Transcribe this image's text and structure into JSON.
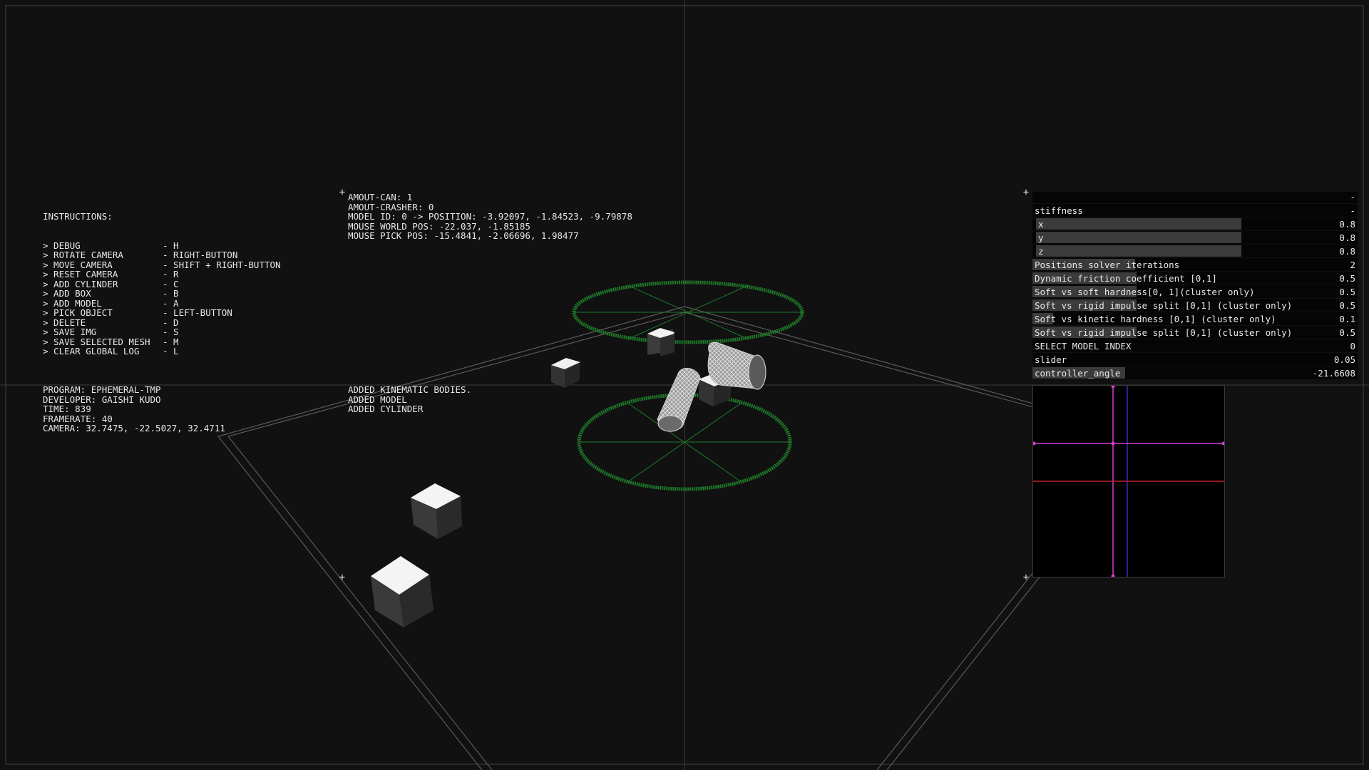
{
  "instructions": {
    "title": "INSTRUCTIONS:",
    "items": [
      {
        "action": "> DEBUG",
        "key": "- H"
      },
      {
        "action": "> ROTATE CAMERA",
        "key": "- RIGHT-BUTTON"
      },
      {
        "action": "> MOVE CAMERA",
        "key": "- SHIFT + RIGHT-BUTTON"
      },
      {
        "action": "> RESET CAMERA",
        "key": "- R"
      },
      {
        "action": "> ADD CYLINDER",
        "key": "- C"
      },
      {
        "action": "> ADD BOX",
        "key": "- B"
      },
      {
        "action": "> ADD MODEL",
        "key": "- A"
      },
      {
        "action": "> PICK OBJECT",
        "key": "- LEFT-BUTTON"
      },
      {
        "action": "> DELETE",
        "key": "- D"
      },
      {
        "action": "> SAVE IMG",
        "key": "- S"
      },
      {
        "action": "> SAVE SELECTED MESH",
        "key": "- M"
      },
      {
        "action": "> CLEAR GLOBAL LOG",
        "key": "- L"
      }
    ]
  },
  "status": {
    "lines": [
      "AMOUT-CAN: 1",
      "AMOUT-CRASHER: 0",
      "MODEL ID: 0 -> POSITION: -3.92097, -1.84523, -9.79878",
      "MOUSE WORLD POS: -22.037, -1.85185",
      "MOUSE PICK POS: -15.4841, -2.06696, 1.98477"
    ]
  },
  "program_info": {
    "lines": [
      "PROGRAM: EPHEMERAL-TMP",
      "DEVELOPER: GAISHI KUDO",
      "TIME: 839",
      "FRAMERATE: 40",
      "CAMERA: 32.7475, -22.5027, 32.4711"
    ]
  },
  "log": {
    "lines": [
      "ADDED KINEMATIC BODIES.",
      "ADDED MODEL",
      "ADDED CYLINDER"
    ]
  },
  "panel": {
    "collapse_symbol": "-",
    "group_label": "stiffness",
    "group_symbol": "-",
    "rows": [
      {
        "label": "x",
        "value": "0.8",
        "fill": 0.8,
        "indent": true
      },
      {
        "label": "y",
        "value": "0.8",
        "fill": 0.8,
        "indent": true
      },
      {
        "label": "z",
        "value": "0.8",
        "fill": 0.8,
        "indent": true
      },
      {
        "label": "Positions solver iterations",
        "value": "2",
        "fill": 0.4
      },
      {
        "label": "Dynamic friction coefficient [0,1]",
        "value": "0.5",
        "fill": 0.405
      },
      {
        "label": "Soft vs soft hardness[0, 1](cluster only)",
        "value": "0.5",
        "fill": 0.405
      },
      {
        "label": "Soft vs rigid impulse split [0,1] (cluster only)",
        "value": "0.5",
        "fill": 0.405
      },
      {
        "label": "Soft vs kinetic hardness [0,1] (cluster only)",
        "value": "0.1",
        "fill": 0.08
      },
      {
        "label": "Soft vs rigid impulse split [0,1] (cluster only)",
        "value": "0.5",
        "fill": 0.405
      },
      {
        "label": "SELECT MODEL INDEX",
        "value": "0",
        "fill": 0
      },
      {
        "label": "slider",
        "value": "0.05",
        "fill": 0
      },
      {
        "label": "controller_angle",
        "value": "-21.6608",
        "fill": 0.36
      }
    ]
  },
  "colors": {
    "background": "#111111",
    "ring": "#1f7a2a",
    "pad_magenta": "#d040d0",
    "pad_blue": "#3030c0",
    "pad_red": "#c02030"
  }
}
